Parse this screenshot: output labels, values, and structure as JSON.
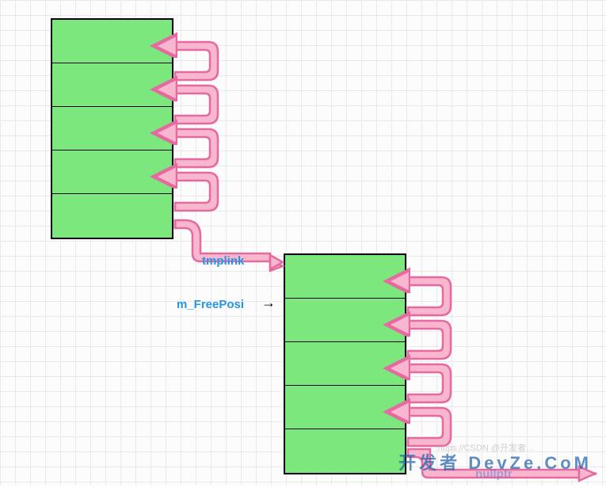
{
  "labels": {
    "tmplink": "tmplink",
    "m_FreePosi": "m_FreePosi",
    "nullptr": "nullptr"
  },
  "watermark": {
    "small": "https://CSDN @开发者…",
    "large": "开发者 DevZe.CoM"
  },
  "diagram": {
    "top_stack_cells": 5,
    "bottom_stack_cells": 5,
    "arrows": {
      "top": [
        {
          "from": 1,
          "to": 0
        },
        {
          "from": 2,
          "to": 1
        },
        {
          "from": 3,
          "to": 2
        },
        {
          "from": 4,
          "to": 3
        }
      ],
      "bottom": [
        {
          "from": 1,
          "to": 0
        },
        {
          "from": 2,
          "to": 1
        },
        {
          "from": 3,
          "to": 2
        },
        {
          "from": 4,
          "to": 3
        }
      ],
      "cross": "top_stack_last → bottom_stack_first (tmplink)",
      "m_FreePosi_points_to": "bottom_stack[1]",
      "bottom_last_to": "nullptr"
    }
  }
}
